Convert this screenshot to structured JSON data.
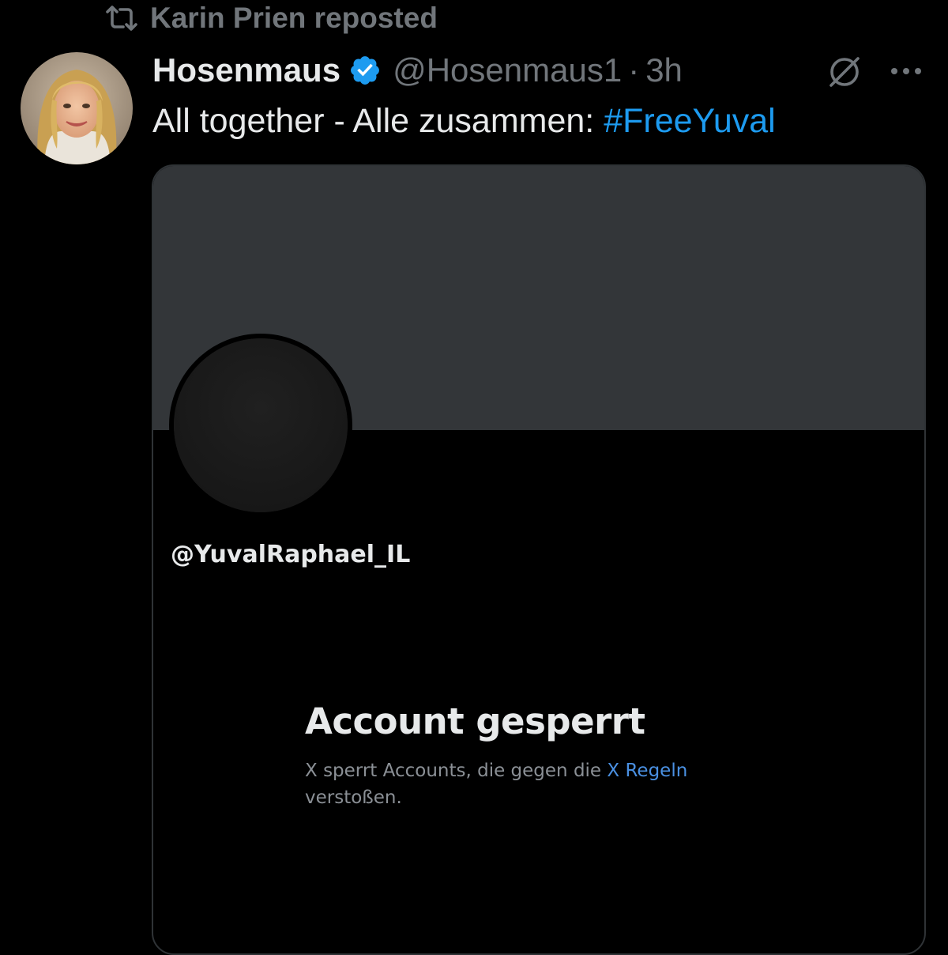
{
  "repost": {
    "icon": "repost-icon",
    "text": "Karin Prien reposted"
  },
  "tweet": {
    "author": {
      "display_name": "Hosenmaus",
      "handle": "@Hosenmaus1",
      "verified_icon": "verified-badge-icon",
      "avatar_icon": "avatar"
    },
    "separator": "·",
    "time": "3h",
    "actions": {
      "grok_icon": "grok-icon",
      "more_icon": "more-icon"
    },
    "text_prefix": "All together - Alle zusammen: ",
    "hashtag": "#FreeYuval",
    "colors": {
      "accent": "#1d9bf0",
      "muted": "#71767b",
      "text": "#e7e9ea",
      "background": "#000000"
    }
  },
  "media": {
    "suspended_handle": "@YuvalRaphael_IL",
    "title": "Account gesperrt",
    "desc_prefix": "X sperrt Accounts, die gegen die ",
    "desc_link": "X Regeln",
    "desc_suffix": "verstoßen."
  }
}
